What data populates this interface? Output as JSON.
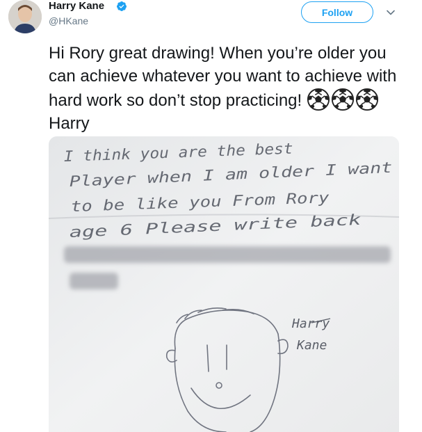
{
  "tweet": {
    "author_name": "Harry Kane",
    "author_handle": "@HKane",
    "follow_label": "Follow",
    "text_before_emoji": "Hi Rory great drawing! When you’re older you can achieve whatever you want to achieve with hard work so don’t stop practicing! ",
    "text_after_emoji": " Harry",
    "emoji": [
      "soccer-ball",
      "soccer-ball",
      "soccer-ball"
    ]
  },
  "photo": {
    "note_lines": [
      "I think you are the best",
      "Player   when I am older I want",
      "to be like you   From Rory",
      "age 6     Please write back"
    ],
    "signature": [
      "Harry",
      "Kane"
    ]
  },
  "colors": {
    "accent": "#1da1f2",
    "text": "#14171a",
    "secondary": "#657786"
  },
  "icons": [
    "verified-badge-icon",
    "chevron-down-icon",
    "soccer-ball-emoji"
  ]
}
